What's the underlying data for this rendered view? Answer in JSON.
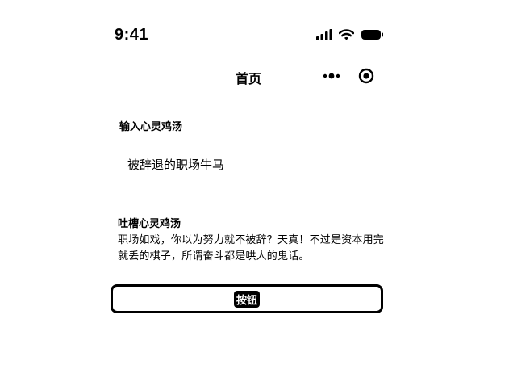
{
  "status_bar": {
    "time": "9:41",
    "icons": [
      "signal-icon",
      "wifi-icon",
      "battery-icon"
    ]
  },
  "nav": {
    "title": "首页",
    "icons": [
      "more-icon",
      "target-icon"
    ]
  },
  "input_section": {
    "label": "输入心灵鸡汤",
    "value": "被辞退的职场牛马"
  },
  "output_section": {
    "label": "吐槽心灵鸡汤",
    "text": "职场如戏，你以为努力就不被辞？天真！不过是资本用完就丢的棋子，所谓奋斗都是哄人的鬼话。"
  },
  "button": {
    "label": "按钮"
  }
}
